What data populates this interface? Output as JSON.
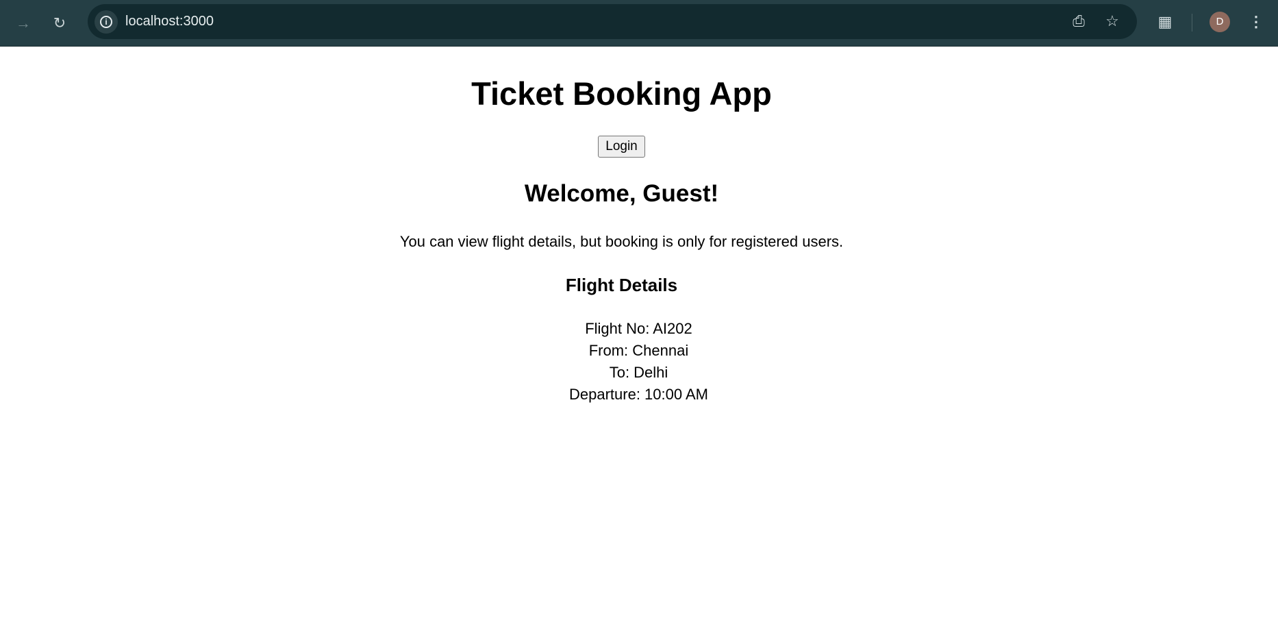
{
  "browser": {
    "url": "localhost:3000",
    "profile_initial": "D",
    "icons": [
      "forward-icon",
      "reload-icon",
      "site-info-icon",
      "install-app-icon",
      "bookmark-star-icon",
      "extensions-icon",
      "menu-icon"
    ]
  },
  "page": {
    "title": "Ticket Booking App",
    "login_label": "Login",
    "welcome": "Welcome, Guest!",
    "message": "You can view flight details, but booking is only for registered users.",
    "details_heading": "Flight Details",
    "details": {
      "flight_no": "Flight No: AI202",
      "from": "From: Chennai",
      "to": "To: Delhi",
      "departure": "Departure: 10:00 AM"
    }
  }
}
